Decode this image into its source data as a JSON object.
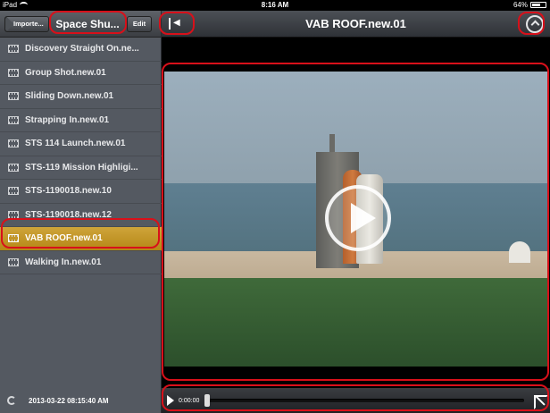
{
  "status_bar": {
    "device": "iPad",
    "time": "8:16 AM",
    "battery_text": "64%",
    "battery_level": 0.64
  },
  "sidebar": {
    "back_label": "Importe...",
    "title": "Space Shu...",
    "edit_label": "Edit",
    "items": [
      {
        "label": "Discovery Straight On.ne..."
      },
      {
        "label": "Group Shot.new.01"
      },
      {
        "label": "Sliding Down.new.01"
      },
      {
        "label": "Strapping In.new.01"
      },
      {
        "label": "STS 114 Launch.new.01"
      },
      {
        "label": "STS-119 Mission Highligi..."
      },
      {
        "label": "STS-1190018.new.10"
      },
      {
        "label": "STS-1190018.new.12"
      },
      {
        "label": "VAB ROOF.new.01",
        "selected": true
      },
      {
        "label": "Walking In.new.01"
      }
    ],
    "footer_timestamp": "2013-03-22 08:15:40 AM"
  },
  "main": {
    "title": "VAB ROOF.new.01",
    "player": {
      "current_time": "0:00:00",
      "progress": 0
    }
  },
  "icons": {
    "list_item": "film-icon",
    "refresh": "refresh-icon",
    "collapse": "collapse-sidebar-icon",
    "share": "share-icon",
    "play": "play-icon",
    "fullscreen": "fullscreen-icon"
  },
  "colors": {
    "selected_row": "#c49a2a",
    "annotation": "#d8101a",
    "sidebar_bg": "#545961"
  }
}
